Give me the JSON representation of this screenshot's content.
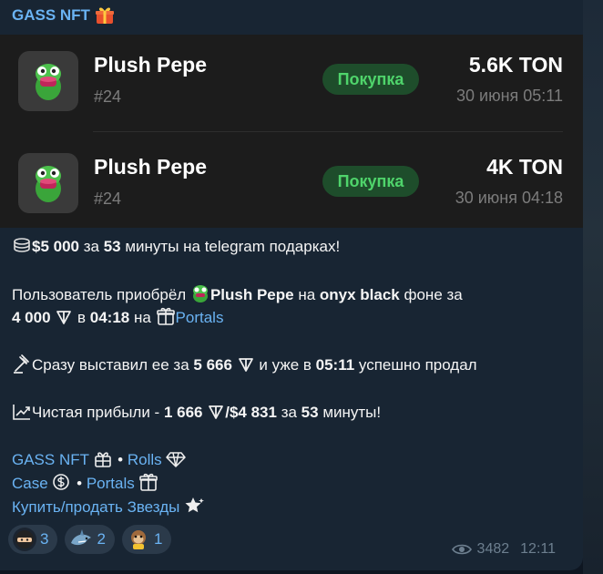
{
  "channel": {
    "name": "GASS NFT"
  },
  "trades": [
    {
      "name": "Plush Pepe",
      "number": "#24",
      "badge": "Покупка",
      "price": "5.6K TON",
      "date": "30 июня 05:11"
    },
    {
      "name": "Plush Pepe",
      "number": "#24",
      "badge": "Покупка",
      "price": "4K TON",
      "date": "30 июня 04:18"
    }
  ],
  "message": {
    "line1": {
      "amount": "$5 000",
      "t1": " за ",
      "minutes": "53",
      "t2": " минуты на telegram подарках!"
    },
    "line2": {
      "t1": "Пользователь приобрёл ",
      "nft": "Plush Pepe",
      "t2": " на ",
      "bg": "onyx black",
      "t3": " фоне за"
    },
    "line3": {
      "amount": "4 000",
      "t1": " в ",
      "time": "04:18",
      "t2": " на ",
      "link": "Portals"
    },
    "line4": {
      "t1": "Сразу выставил ее за ",
      "amount": "5 666",
      "t2": " и уже в ",
      "time": "05:11",
      "t3": " успешно продал"
    },
    "line5": {
      "t1": "Чистая прибыли - ",
      "amount": "1 666",
      "t2": "/",
      "usd": "$4 831",
      "t3": " за ",
      "minutes": "53",
      "t4": " минуты!"
    },
    "links": {
      "gass": "GASS NFT",
      "sep1": " • ",
      "rolls": "Rolls",
      "case": "Case",
      "sep2": " • ",
      "portals": "Portals",
      "stars": "Купить/продать Звезды"
    }
  },
  "reactions": [
    {
      "icon": "ninja-emoji",
      "count": "3"
    },
    {
      "icon": "shark-emoji",
      "count": "2"
    },
    {
      "icon": "monkey-emoji",
      "count": "1"
    }
  ],
  "footer": {
    "views": "3482",
    "time": "12:11"
  },
  "colors": {
    "accent": "#6ab3f3",
    "badge_text": "#4fd46b",
    "badge_bg": "#1e4d2b",
    "bubble": "#182533"
  }
}
